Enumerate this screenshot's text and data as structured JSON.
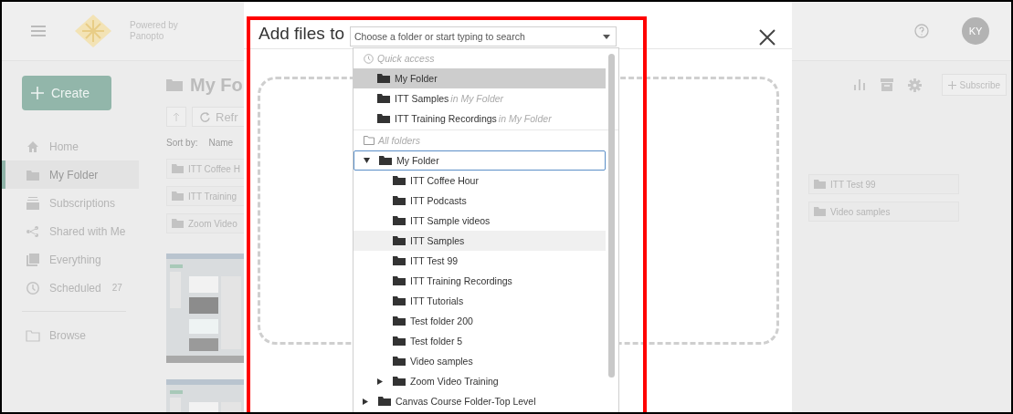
{
  "topbar": {
    "brand": [
      "Powered by",
      "Panopto"
    ],
    "avatar": "KY"
  },
  "sidebar": {
    "create": "Create",
    "items": [
      {
        "label": "Home",
        "selected": false
      },
      {
        "label": "My Folder",
        "selected": true
      },
      {
        "label": "Subscriptions",
        "selected": false
      },
      {
        "label": "Shared with Me",
        "selected": false
      },
      {
        "label": "Everything",
        "selected": false
      },
      {
        "label": "Scheduled",
        "selected": false,
        "count": "27"
      }
    ],
    "browse": "Browse"
  },
  "content": {
    "title": "My Fo",
    "refresh": "Refr",
    "sort_label": "Sort by:",
    "sort_value": "Name",
    "folders": [
      "ITT Coffee H",
      "ITT Training",
      "Zoom Video"
    ],
    "right_folders": [
      "ITT Test 99",
      "Video samples"
    ],
    "subscribe": "Subscribe"
  },
  "modal": {
    "title": "Add files to",
    "picker": {
      "placeholder": "Choose a folder or start typing to search",
      "quick_access": {
        "label": "Quick access",
        "items": [
          {
            "name": "My Folder",
            "selected": true
          },
          {
            "name": "ITT Samples",
            "location": "in My Folder",
            "selected": false
          },
          {
            "name": "ITT Training Recordings",
            "location": "in My Folder",
            "selected": false
          }
        ]
      },
      "all_folders": {
        "label": "All folders",
        "tree": [
          {
            "name": "My Folder",
            "expanded": true,
            "selected": true,
            "hovered": false,
            "children": [
              {
                "name": "ITT Coffee Hour",
                "selected": false,
                "hovered": false
              },
              {
                "name": "ITT Podcasts",
                "selected": false,
                "hovered": false
              },
              {
                "name": "ITT Sample videos",
                "selected": false,
                "hovered": false
              },
              {
                "name": "ITT Samples",
                "selected": false,
                "hovered": true
              },
              {
                "name": "ITT Test 99",
                "selected": false,
                "hovered": false
              },
              {
                "name": "ITT Training Recordings",
                "selected": false,
                "hovered": false
              },
              {
                "name": "ITT Tutorials",
                "selected": false,
                "hovered": false
              },
              {
                "name": "Test folder 200",
                "selected": false,
                "hovered": false
              },
              {
                "name": "Test folder 5",
                "selected": false,
                "hovered": false
              },
              {
                "name": "Video samples",
                "selected": false,
                "hovered": false
              },
              {
                "name": "Zoom Video Training",
                "expanded": false,
                "selected": false,
                "hovered": false
              }
            ]
          },
          {
            "name": "Canvas Course Folder-Top Level",
            "expanded": false,
            "selected": false,
            "hovered": false
          }
        ]
      }
    }
  }
}
